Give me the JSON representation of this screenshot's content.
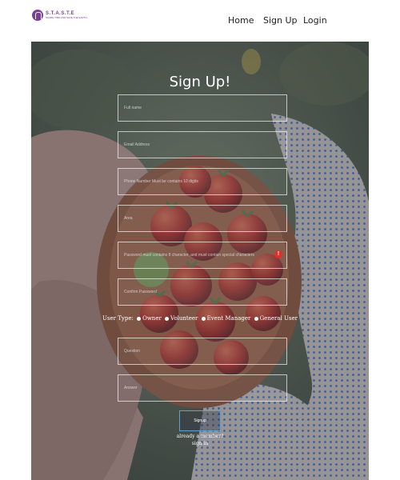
{
  "brand": {
    "title": "S.T.A.S.T.E",
    "subtitle": "SHARE TIME AND SAVE THE EARTH"
  },
  "nav": {
    "home": "Home",
    "signup": "Sign Up",
    "login": "Login"
  },
  "form": {
    "heading": "Sign Up!",
    "full_name_placeholder": "Full name",
    "email_placeholder": "Email Address",
    "phone_placeholder": "Phone Number Must be contains 10 digits",
    "area_placeholder": "Area",
    "password_placeholder": "Password must contains 8 character, and must contain special characters",
    "confirm_placeholder": "Confirm Password",
    "error_badge": "!",
    "user_type_label": "User Type:",
    "user_types": [
      "Owner",
      "Volunteer",
      "Event Manager",
      "General User"
    ],
    "question_placeholder": "Question",
    "answer_placeholder": "Answer",
    "submit_label": "Signup",
    "already_member": "already a member?",
    "sign_in": "sign in"
  },
  "colors": {
    "brand": "#7b3f98",
    "error": "#e0302a",
    "button_border": "#5aa0d8"
  }
}
